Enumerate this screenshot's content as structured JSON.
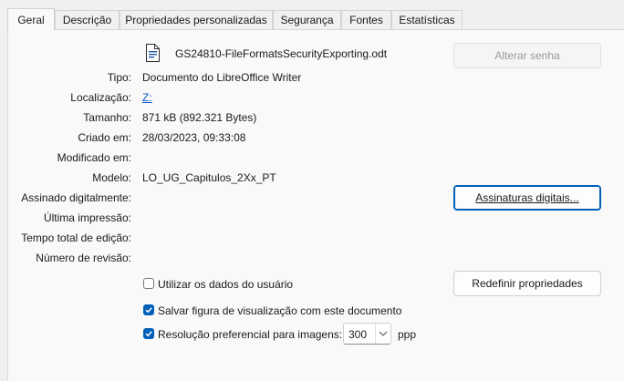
{
  "tabs": [
    {
      "label": "Geral"
    },
    {
      "label": "Descrição"
    },
    {
      "label": "Propriedades personalizadas"
    },
    {
      "label": "Segurança"
    },
    {
      "label": "Fontes"
    },
    {
      "label": "Estatísticas"
    }
  ],
  "file": {
    "name": "GS24810-FileFormatsSecurityExporting.odt",
    "icon": "document-icon"
  },
  "buttons": {
    "change_password": "Alterar senha",
    "digital_signatures": "Assinaturas digitais...",
    "reset_properties": "Redefinir propriedades"
  },
  "fields": {
    "type": {
      "label": "Tipo:",
      "value": "Documento do LibreOffice Writer"
    },
    "location": {
      "label": "Localização:",
      "value": "Z:"
    },
    "size": {
      "label": "Tamanho:",
      "value": "871 kB (892.321 Bytes)"
    },
    "created": {
      "label": "Criado em:",
      "value": "28/03/2023, 09:33:08"
    },
    "modified": {
      "label": "Modificado em:",
      "value": ""
    },
    "template": {
      "label": "Modelo:",
      "value": "LO_UG_Capitulos_2Xx_PT"
    },
    "signed": {
      "label": "Assinado digitalmente:",
      "value": ""
    },
    "last_printed": {
      "label": "Última impressão:",
      "value": ""
    },
    "editing_time": {
      "label": "Tempo total de edição:",
      "value": ""
    },
    "revision": {
      "label": "Número de revisão:",
      "value": ""
    }
  },
  "options": {
    "use_user_data": {
      "label": "Utilizar os dados do usuário",
      "checked": false
    },
    "save_preview": {
      "label": "Salvar figura de visualização com este documento",
      "checked": true
    },
    "preferred_resolution": {
      "label": "Resolução preferencial para imagens:",
      "checked": true,
      "value": "300",
      "unit": "ppp"
    }
  },
  "colors": {
    "accent": "#005fb8",
    "link": "#0b57d0"
  }
}
